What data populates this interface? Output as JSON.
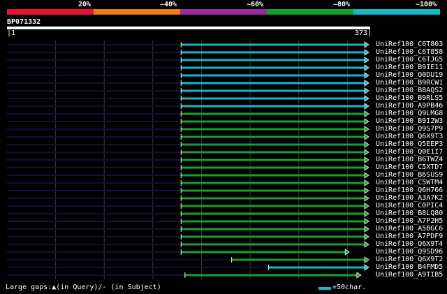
{
  "legend": {
    "labels": [
      "20%",
      "~40%",
      "~60%",
      "~80%",
      "~100%"
    ],
    "colors": [
      "#e8132f",
      "#f07a13",
      "#9b2ba0",
      "#16a12a",
      "#11b8c8"
    ]
  },
  "query": {
    "id": "BP071332",
    "start": "1",
    "end": "373",
    "length": 373
  },
  "hits": [
    {
      "name": "UniRef100_C6T803",
      "start": 180,
      "end": 373,
      "color": "#11b8c8"
    },
    {
      "name": "UniRef100_C6T858",
      "start": 180,
      "end": 373,
      "color": "#11b8c8"
    },
    {
      "name": "UniRef100_C6TJG5",
      "start": 180,
      "end": 373,
      "color": "#11b8c8"
    },
    {
      "name": "UniRef100_B9IE11",
      "start": 180,
      "end": 373,
      "color": "#11b8c8"
    },
    {
      "name": "UniRef100_Q0DU19",
      "start": 180,
      "end": 373,
      "color": "#11b8c8"
    },
    {
      "name": "UniRef100_B9RCW1",
      "start": 180,
      "end": 373,
      "color": "#11b8c8"
    },
    {
      "name": "UniRef100_B8AQS2",
      "start": 180,
      "end": 373,
      "color": "#11b8c8"
    },
    {
      "name": "UniRef100_B9RLS5",
      "start": 180,
      "end": 373,
      "color": "#11b8c8"
    },
    {
      "name": "UniRef100_A9PB46",
      "start": 180,
      "end": 373,
      "color": "#11b8c8"
    },
    {
      "name": "UniRef100_Q9LMG8",
      "start": 180,
      "end": 373,
      "color": "#16a12a"
    },
    {
      "name": "UniRef100_B9I2W3",
      "start": 180,
      "end": 373,
      "color": "#16a12a"
    },
    {
      "name": "UniRef100_Q9S7P9",
      "start": 180,
      "end": 373,
      "color": "#16a12a"
    },
    {
      "name": "UniRef100_Q6X9T3",
      "start": 180,
      "end": 373,
      "color": "#16a12a"
    },
    {
      "name": "UniRef100_Q5EEP3",
      "start": 180,
      "end": 373,
      "color": "#16a12a"
    },
    {
      "name": "UniRef100_Q0E1I7",
      "start": 180,
      "end": 373,
      "color": "#16a12a"
    },
    {
      "name": "UniRef100_B6TWZ4",
      "start": 180,
      "end": 373,
      "color": "#16a12a"
    },
    {
      "name": "UniRef100_C5XTD7",
      "start": 180,
      "end": 373,
      "color": "#16a12a"
    },
    {
      "name": "UniRef100_B6SUS9",
      "start": 180,
      "end": 373,
      "color": "#16a12a"
    },
    {
      "name": "UniRef100_C5WTM4",
      "start": 180,
      "end": 373,
      "color": "#16a12a"
    },
    {
      "name": "UniRef100_Q6H766",
      "start": 180,
      "end": 373,
      "color": "#16a12a"
    },
    {
      "name": "UniRef100_A3A7K2",
      "start": 180,
      "end": 373,
      "color": "#16a12a"
    },
    {
      "name": "UniRef100_C0PIC4",
      "start": 180,
      "end": 373,
      "color": "#16a12a"
    },
    {
      "name": "UniRef100_B8LQ80",
      "start": 180,
      "end": 373,
      "color": "#16a12a"
    },
    {
      "name": "UniRef100_A7P2H5",
      "start": 180,
      "end": 373,
      "color": "#16a12a"
    },
    {
      "name": "UniRef100_A5BGC6",
      "start": 180,
      "end": 373,
      "color": "#16a12a"
    },
    {
      "name": "UniRef100_A7PDF9",
      "start": 180,
      "end": 373,
      "color": "#16a12a"
    },
    {
      "name": "UniRef100_Q6X9T4",
      "start": 180,
      "end": 373,
      "color": "#16a12a"
    },
    {
      "name": "UniRef100_Q9SD96",
      "start": 180,
      "end": 353,
      "color": "#16a12a"
    },
    {
      "name": "UniRef100_Q6X9T2",
      "start": 232,
      "end": 373,
      "color": "#16a12a"
    },
    {
      "name": "UniRef100_B4FMD5",
      "start": 270,
      "end": 373,
      "color": "#11b8c8"
    },
    {
      "name": "UniRef100_A9TIB5",
      "start": 184,
      "end": 365,
      "color": "#16a12a"
    }
  ],
  "footer": {
    "large_gaps": "Large gaps:▲(in Query)/- (in Subject)",
    "scale": "=50char."
  }
}
